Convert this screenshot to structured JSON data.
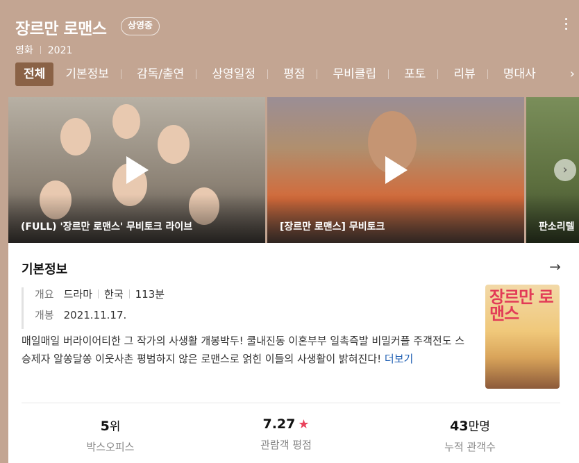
{
  "header": {
    "title": "장르만 로맨스",
    "status_badge": "상영중",
    "category": "영화",
    "year": "2021"
  },
  "tabs": [
    {
      "label": "전체",
      "active": true
    },
    {
      "label": "기본정보"
    },
    {
      "label": "감독/출연"
    },
    {
      "label": "상영일정"
    },
    {
      "label": "평점"
    },
    {
      "label": "무비클립"
    },
    {
      "label": "포토"
    },
    {
      "label": "리뷰"
    },
    {
      "label": "명대사"
    }
  ],
  "videos": [
    {
      "caption": "(FULL) '장르만 로맨스' 무비토크 라이브"
    },
    {
      "caption": "[장르만 로맨스] 무비토크"
    },
    {
      "caption": "판소리텔"
    }
  ],
  "basic_info": {
    "section_title": "기본정보",
    "overview_label": "개요",
    "genre": "드라마",
    "country": "한국",
    "runtime": "113분",
    "release_label": "개봉",
    "release_date": "2021.11.17.",
    "description": "매일매일 버라이어티한 그 작가의 사생활 개봉박두! 쿨내진동 이혼부부 일촉즉발 비밀커플 주객전도 스승제자 알쏭달쏭 이웃사촌 평범하지 않은 로맨스로 얽힌 이들의 사생활이 밝혀진다!",
    "more_link": "더보기",
    "poster_title": "장르만 로맨스"
  },
  "stats": [
    {
      "value": "5",
      "unit": "위",
      "label": "박스오피스"
    },
    {
      "value": "7.27",
      "unit": "",
      "label": "관람객 평점"
    },
    {
      "value": "43",
      "unit": "만명",
      "label": "누적 관객수"
    }
  ],
  "colors": {
    "header_bg": "#c3a592",
    "active_tab": "#8a6246",
    "link": "#1f5fb3",
    "star": "#e9435c"
  }
}
